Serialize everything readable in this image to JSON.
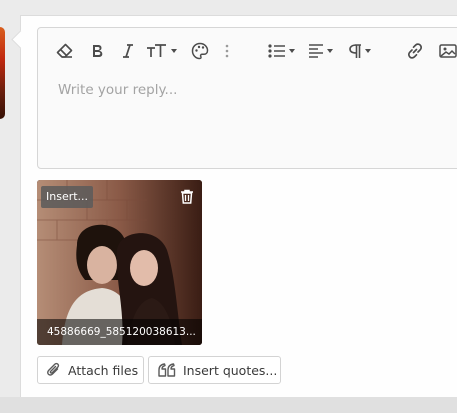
{
  "editor": {
    "placeholder": "Write your reply...",
    "toolbar": [
      {
        "name": "eraser-icon",
        "label": "Clear formatting"
      },
      {
        "name": "bold-icon",
        "label": "Bold"
      },
      {
        "name": "italic-icon",
        "label": "Italic"
      },
      {
        "name": "font-size-icon",
        "label": "Font size"
      },
      {
        "name": "palette-icon",
        "label": "Text color"
      },
      {
        "name": "more-options-icon",
        "label": "More options"
      },
      {
        "name": "list-icon",
        "label": "List"
      },
      {
        "name": "align-icon",
        "label": "Alignment"
      },
      {
        "name": "paragraph-icon",
        "label": "Paragraph format"
      },
      {
        "name": "link-icon",
        "label": "Insert link"
      },
      {
        "name": "image-icon",
        "label": "Insert image"
      }
    ]
  },
  "attachment": {
    "insert_label": "Insert...",
    "filename": "45886669_585120038613...",
    "delete_icon": "trash-icon"
  },
  "actions": {
    "attach_label": "Attach files",
    "attach_icon": "paperclip-icon",
    "quotes_label": "Insert quotes...",
    "quotes_icon": "quote-icon"
  },
  "colors": {
    "panel_bg": "#fefefe",
    "page_bg": "#ebebeb",
    "icon": "#4c4c4c",
    "placeholder": "#a3a3a3"
  }
}
